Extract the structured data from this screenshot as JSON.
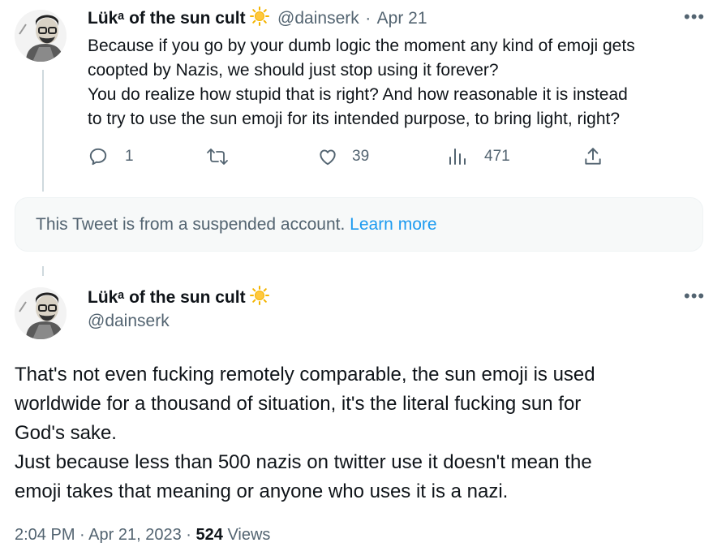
{
  "reply_tweet": {
    "author_name": "Lükᵃ of the sun cult",
    "handle": "@dainserk",
    "separator": "·",
    "date": "Apr 21",
    "more_label": "•••",
    "text_lines": [
      "Because if you go by your dumb logic the moment any kind of emoji gets",
      "coopted by Nazis, we should just stop using it forever?",
      "You do realize how stupid that is right? And how reasonable it is instead",
      "to try to use the sun emoji for its intended purpose, to bring light, right?"
    ],
    "actions": {
      "reply_count": "1",
      "retweet_count": "",
      "like_count": "39",
      "views_count": "471"
    }
  },
  "suspended_notice": {
    "text": "This Tweet is from a suspended account.",
    "link": "Learn more"
  },
  "main_tweet": {
    "author_name": "Lükᵃ of the sun cult",
    "handle": "@dainserk",
    "more_label": "•••",
    "text_lines": [
      "That's not even fucking remotely comparable, the sun emoji is used",
      "worldwide for a thousand of situation, it's the literal fucking sun for",
      "God's sake.",
      "Just because less than 500 nazis on twitter use it doesn't mean the",
      "emoji takes that meaning or anyone who uses it is a nazi."
    ],
    "time": "2:04 PM",
    "separator": "·",
    "date": "Apr 21, 2023",
    "views_count": "524",
    "views_label": "Views"
  },
  "icons": {
    "reply": "comment-icon",
    "retweet": "retweet-icon",
    "like": "heart-icon",
    "views": "analytics-icon",
    "share": "share-icon",
    "sun": "sun-emoji-icon"
  },
  "colors": {
    "text_primary": "#0f1419",
    "text_secondary": "#536471",
    "link": "#1d9bf0",
    "sun": "#f4b400",
    "notice_bg": "#f7f9f9"
  }
}
